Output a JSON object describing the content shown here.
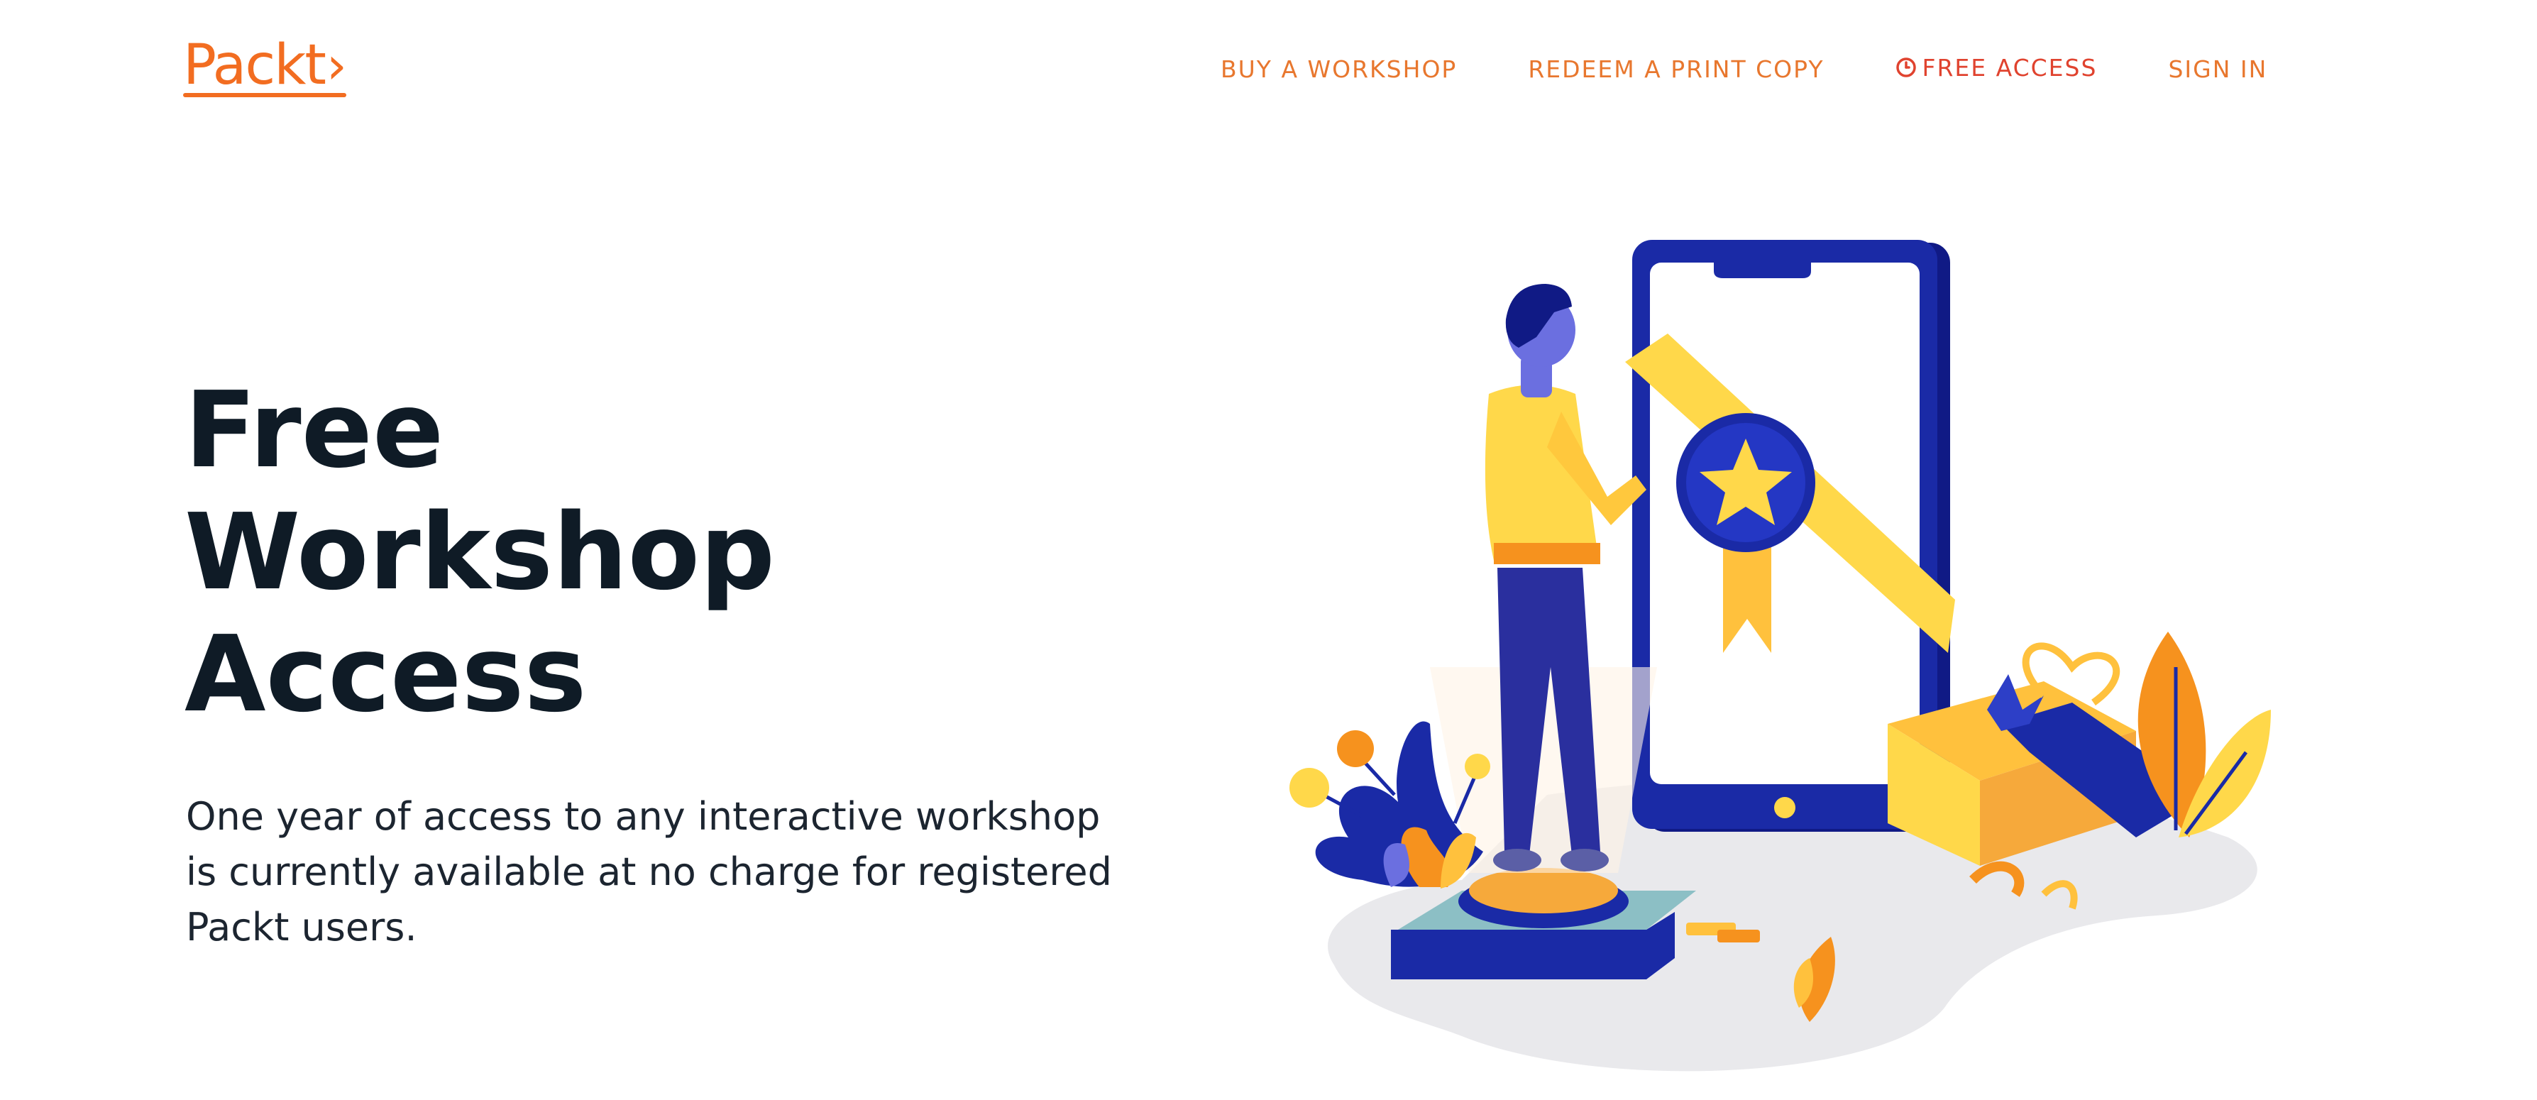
{
  "brand": {
    "logo_text": "Packt",
    "logo_chevron": "›",
    "accent_color": "#f26d21",
    "alert_color": "#e0432f"
  },
  "nav": {
    "items": [
      {
        "label": "BUY A WORKSHOP"
      },
      {
        "label": "REDEEM A PRINT COPY"
      },
      {
        "label": "FREE ACCESS",
        "icon": "clock-icon"
      },
      {
        "label": "SIGN IN"
      }
    ]
  },
  "hero": {
    "title_lines": [
      "Free",
      "Workshop",
      "Access"
    ],
    "description": "One year of access to any interactive workshop is currently available at no charge for registered Packt users."
  },
  "colors": {
    "title_text": "#0f1b26",
    "phone_blue": "#1a2aa6",
    "figure_yellow": "#ffd84a",
    "leaf_orange": "#f6921e"
  }
}
